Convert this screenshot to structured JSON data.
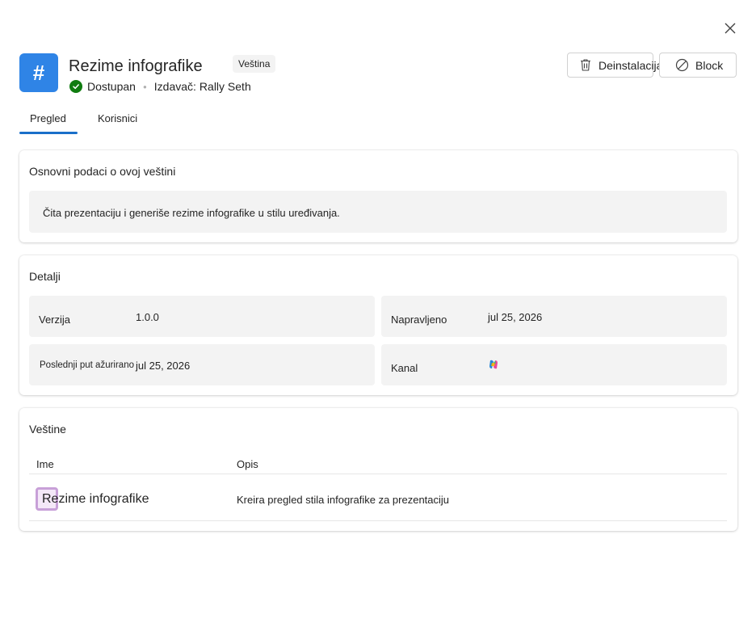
{
  "header": {
    "title": "Rezime infografike",
    "type_badge": "Veština",
    "status": "Dostupan",
    "publisher_label": "Izdavač:",
    "publisher": "Rally Seth",
    "icon_glyph": "#",
    "icon_color": "#2f84e6"
  },
  "actions": {
    "uninstall_label": "Deinstalacija",
    "block_label": "Block"
  },
  "tabs": [
    {
      "label": "Pregled",
      "active": true
    },
    {
      "label": "Korisnici",
      "active": false
    }
  ],
  "about": {
    "title": "Osnovni podaci o ovoj veštini",
    "description": "Čita prezentaciju i generiše rezime infografike u stilu uređivanja."
  },
  "details": {
    "title": "Detalji",
    "version_label": "Verzija",
    "version": "1.0.0",
    "created_label": "Napravljeno",
    "created": "jul 25, 2026",
    "updated_label": "Poslednji put ažurirano",
    "updated": "jul 25, 2026",
    "channel_label": "Kanal",
    "channel_icon": "copilot-icon"
  },
  "skills": {
    "title": "Veštine",
    "columns": [
      "Ime",
      "Opis"
    ],
    "rows": [
      {
        "name": "Rezime infografike",
        "description": "Kreira pregled stila infografike za prezentaciju"
      }
    ]
  },
  "colors": {
    "accent": "#1a6fc9",
    "status_ok": "#107c10"
  }
}
